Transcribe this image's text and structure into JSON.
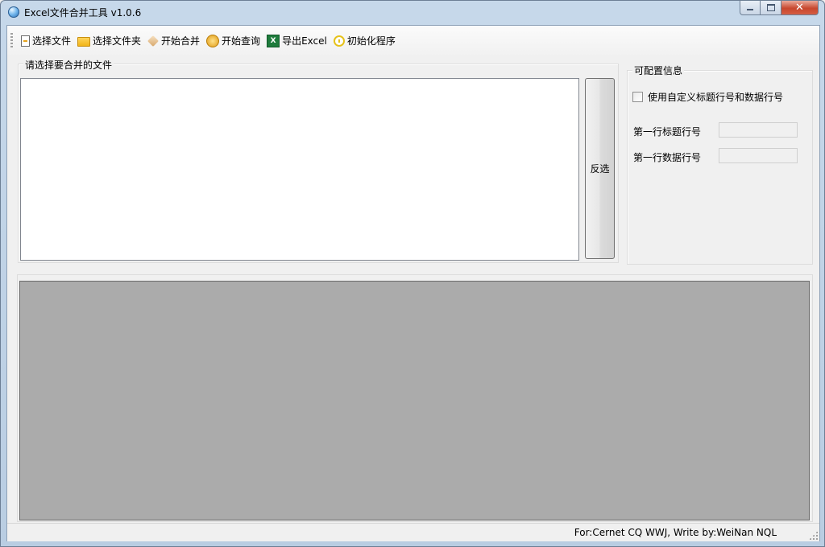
{
  "window": {
    "title": "Excel文件合并工具 v1.0.6",
    "close_glyph": "✕"
  },
  "toolbar": {
    "items": [
      {
        "label": "选择文件",
        "icon": "file-icon"
      },
      {
        "label": "选择文件夹",
        "icon": "folder-icon"
      },
      {
        "label": "开始合并",
        "icon": "merge-icon"
      },
      {
        "label": "开始查询",
        "icon": "query-icon"
      },
      {
        "label": "导出Excel",
        "icon": "excel-icon",
        "icon_text": "X"
      },
      {
        "label": "初始化程序",
        "icon": "init-icon"
      }
    ]
  },
  "file_group": {
    "legend": "请选择要合并的文件",
    "invert_label": "反选"
  },
  "config_group": {
    "legend": "可配置信息",
    "checkbox_label": "使用自定义标题行号和数据行号",
    "checkbox_checked": false,
    "header_row_label": "第一行标题行号",
    "header_row_value": "",
    "data_row_label": "第一行数据行号",
    "data_row_value": ""
  },
  "status": {
    "text": "For:Cernet CQ WWJ, Write by:WeiNan NQL"
  },
  "colors": {
    "result_area": "#ababab",
    "window_frame": "#b9cde2",
    "close_button": "#c7472e"
  }
}
